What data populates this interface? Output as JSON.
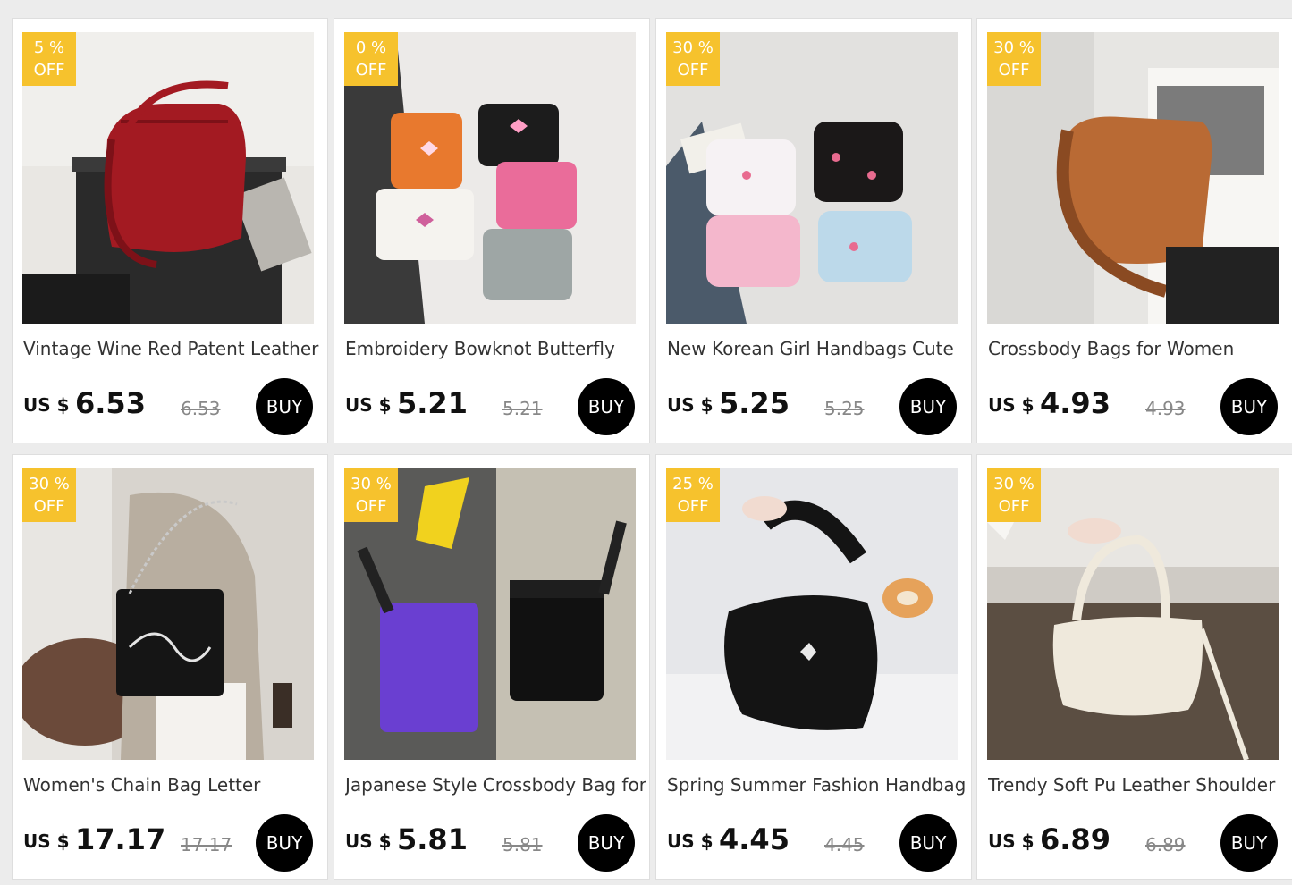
{
  "products": [
    {
      "discount_value": "5  %",
      "discount_word": "OFF",
      "title": "Vintage Wine Red Patent Leather",
      "currency": "US $",
      "price": "6.53",
      "original_price": "6.53",
      "buy_label": "BUY",
      "image": "red-patent-shoulder-bag",
      "image_colors": [
        "#e9e7e3",
        "#a31a22"
      ]
    },
    {
      "discount_value": "0  %",
      "discount_word": "OFF",
      "title": "Embroidery Bowknot Butterfly",
      "currency": "US $",
      "price": "5.21",
      "original_price": "5.21",
      "buy_label": "BUY",
      "image": "butterfly-bags-assortment",
      "image_colors": [
        "#eceae8",
        "#e8792e"
      ]
    },
    {
      "discount_value": "30  %",
      "discount_word": "OFF",
      "title": "New Korean Girl Handbags Cute",
      "currency": "US $",
      "price": "5.25",
      "original_price": "5.25",
      "buy_label": "BUY",
      "image": "floral-ruched-handbags",
      "image_colors": [
        "#e2e1df",
        "#f4b7cc"
      ]
    },
    {
      "discount_value": "30  %",
      "discount_word": "OFF",
      "title": "Crossbody Bags for Women",
      "currency": "US $",
      "price": "4.93",
      "original_price": "4.93",
      "buy_label": "BUY",
      "image": "brown-crossbody-bag",
      "image_colors": [
        "#e7e6e3",
        "#b96a34"
      ]
    },
    {
      "discount_value": "30  %",
      "discount_word": "OFF",
      "title": "Women's Chain Bag Letter",
      "currency": "US $",
      "price": "17.17",
      "original_price": "17.17",
      "buy_label": "BUY",
      "image": "black-chain-bag",
      "image_colors": [
        "#d8d4ce",
        "#151515"
      ]
    },
    {
      "discount_value": "30  %",
      "discount_word": "OFF",
      "title": "Japanese Style Crossbody Bag for",
      "currency": "US $",
      "price": "5.81",
      "original_price": "5.81",
      "buy_label": "BUY",
      "image": "purple-black-crossbody-bags",
      "image_colors": [
        "#8a8880",
        "#6a3fd1"
      ]
    },
    {
      "discount_value": "25  %",
      "discount_word": "OFF",
      "title": "Spring Summer Fashion Handbag",
      "currency": "US $",
      "price": "4.45",
      "original_price": "4.45",
      "buy_label": "BUY",
      "image": "black-nylon-handbag",
      "image_colors": [
        "#e6e7ea",
        "#141414"
      ]
    },
    {
      "discount_value": "30  %",
      "discount_word": "OFF",
      "title": "Trendy Soft Pu Leather Shoulder",
      "currency": "US $",
      "price": "6.89",
      "original_price": "6.89",
      "buy_label": "BUY",
      "image": "white-knot-handbag",
      "image_colors": [
        "#cfcbc5",
        "#efe9dc"
      ]
    }
  ]
}
